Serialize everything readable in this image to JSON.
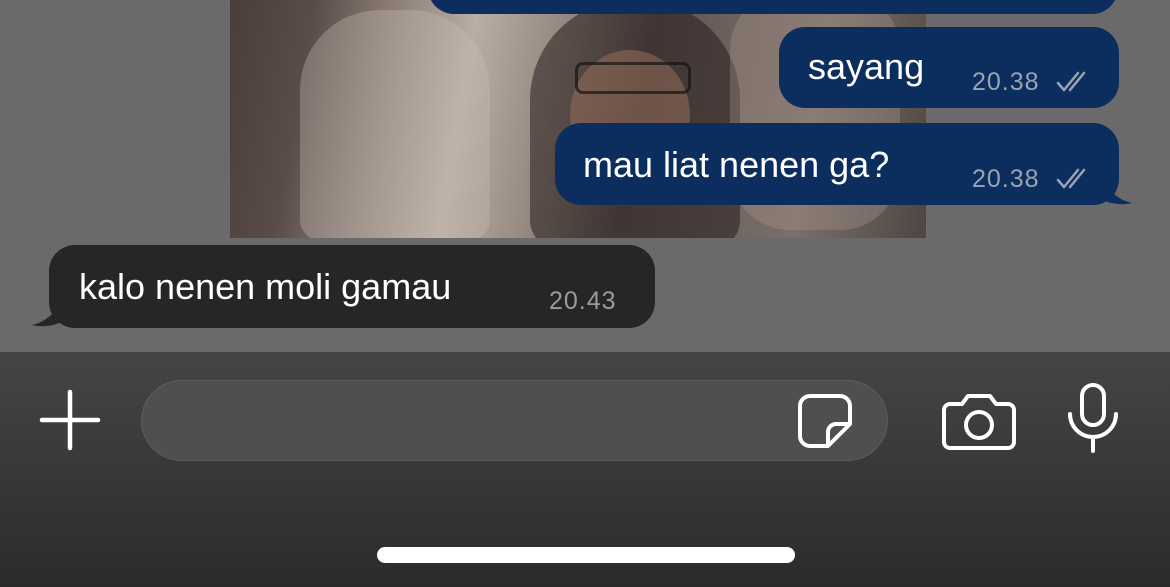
{
  "messages": [
    {
      "direction": "out",
      "text": "sayang",
      "time": "20.38",
      "status": "read"
    },
    {
      "direction": "out",
      "text": "mau liat nenen ga?",
      "time": "20.38",
      "status": "read"
    },
    {
      "direction": "in",
      "text": "kalo nenen moli gamau",
      "time": "20.43"
    }
  ],
  "composer": {
    "message_value": "",
    "icons": {
      "attach": "plus-icon",
      "sticker": "sticker-icon",
      "camera": "camera-icon",
      "voice": "microphone-icon"
    }
  },
  "colors": {
    "outgoing_bubble": "#0b2e5e",
    "incoming_bubble": "#262626",
    "chat_background": "#6a6a6a"
  }
}
